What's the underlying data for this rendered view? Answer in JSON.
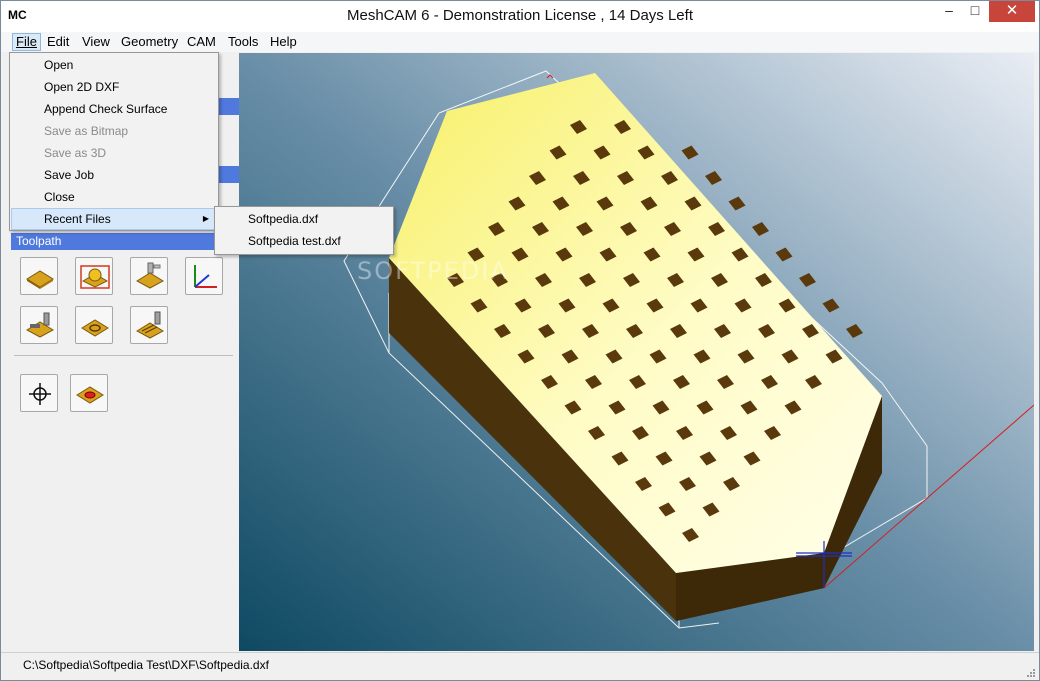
{
  "window": {
    "logo": "MC",
    "title": "MeshCAM 6 - Demonstration License  , 14 Days Left",
    "min_glyph": "–",
    "max_glyph": "□",
    "close_glyph": "✕"
  },
  "menubar": {
    "file": "File",
    "edit": "Edit",
    "view": "View",
    "geometry": "Geometry",
    "cam": "CAM",
    "tools": "Tools",
    "help": "Help"
  },
  "file_menu": {
    "items": [
      {
        "label": "Open",
        "enabled": true
      },
      {
        "label": "Open 2D DXF",
        "enabled": true
      },
      {
        "label": "Append Check Surface",
        "enabled": true
      },
      {
        "label": "Save as Bitmap",
        "enabled": false
      },
      {
        "label": "Save as 3D",
        "enabled": false
      },
      {
        "label": "Save Job",
        "enabled": true
      },
      {
        "label": "Close",
        "enabled": true
      },
      {
        "label": "Recent Files",
        "enabled": true,
        "submenu": true
      }
    ]
  },
  "recent_files": {
    "items": [
      "Softpedia.dxf",
      "Softpedia test.dxf"
    ]
  },
  "left_panel": {
    "toolpath_header": "Toolpath",
    "tool_icons": [
      "waterline-icon",
      "rough-sphere-icon",
      "finish-tool-icon",
      "axis-origin-icon",
      "drill-icon",
      "pencil-tool-icon",
      "raster-tool-icon",
      "crosshair-icon",
      "region-icon"
    ]
  },
  "status_bar": {
    "path": "C:\\Softpedia\\Softpedia Test\\DXF\\Softpedia.dxf"
  },
  "watermark": "SOFTPEDIA",
  "colors": {
    "header_blue": "#4f79dd",
    "menu_hover": "#d6e8f9",
    "part_top": "#fffec4",
    "part_side": "#4a320c"
  }
}
